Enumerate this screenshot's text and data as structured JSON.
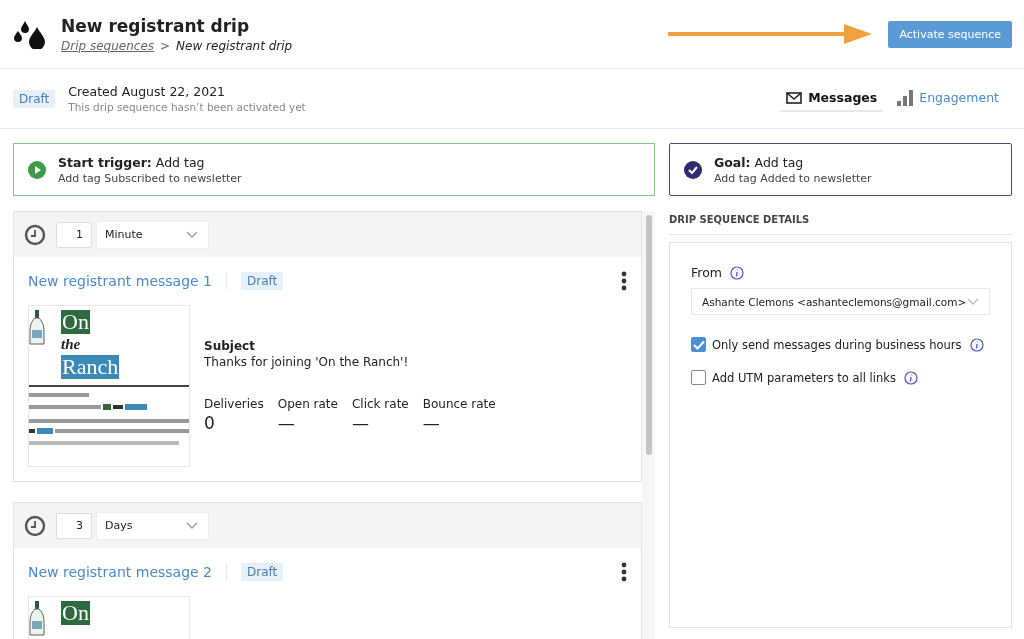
{
  "header": {
    "title": "New registrant drip",
    "breadcrumb": [
      {
        "label": "Drip sequences",
        "kind": "link"
      },
      {
        "label": ">",
        "kind": "separator"
      },
      {
        "label": "New registrant drip",
        "kind": "current"
      }
    ],
    "primary_button": "Activate sequence"
  },
  "status": {
    "badge": "Draft",
    "created": "Created August 22, 2021",
    "note": "This drip sequence hasn’t been activated yet"
  },
  "tabs": [
    {
      "label": "Messages",
      "selected": true
    },
    {
      "label": "Engagement",
      "selected": false
    }
  ],
  "trigger": {
    "label": "Start trigger:",
    "value": "Add tag",
    "detail": "Add tag Subscribed to newsletter"
  },
  "goal": {
    "label": "Goal:",
    "value": "Add tag",
    "detail": "Add tag Added to newsletter"
  },
  "steps": [
    {
      "delay": "1",
      "unit": "Minute",
      "title": "New registrant message 1",
      "badge": "Draft",
      "subject_label": "Subject",
      "subject": "Thanks for joining 'On the Ranch'!",
      "stats": [
        {
          "label": "Deliveries",
          "value": "0"
        },
        {
          "label": "Open rate",
          "value": "—"
        },
        {
          "label": "Click rate",
          "value": "—"
        },
        {
          "label": "Bounce rate",
          "value": "—"
        }
      ],
      "preview": {
        "logo": [
          "On",
          "the",
          "Ranch"
        ],
        "body": {
          "kind": "picture"
        }
      }
    },
    {
      "delay": "3",
      "unit": "Days",
      "title": "New registrant message 2",
      "badge": "Draft",
      "preview": {
        "logo": [
          "On"
        ]
      }
    }
  ],
  "details": {
    "heading": "DRIP SEQUENCE DETAILS",
    "from_label": "From",
    "from_value": "Ashante Clemons <ashanteclemons@gmail.com>",
    "options": [
      {
        "label": "Only send messages during business hours",
        "checked": true
      },
      {
        "label": "Add UTM parameters to all links",
        "checked": false
      }
    ]
  }
}
